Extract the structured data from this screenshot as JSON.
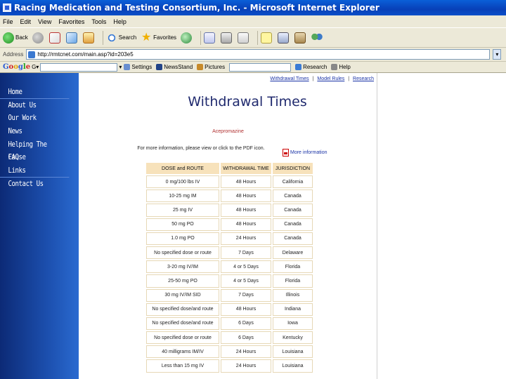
{
  "window": {
    "title": "Racing Medication and Testing Consortium, Inc. - Microsoft Internet Explorer"
  },
  "menubar": {
    "items": [
      "File",
      "Edit",
      "View",
      "Favorites",
      "Tools",
      "Help"
    ]
  },
  "toolbar": {
    "back_label": "Back",
    "search_label": "Search",
    "favorites_label": "Favorites"
  },
  "addressbar": {
    "label": "Address",
    "url": "http://rmtcnet.com/main.asp?id=203e5"
  },
  "googlebar": {
    "logo": "Google",
    "settings_label": "Settings",
    "newsstand_label": "NewsStand",
    "pictures_label": "Pictures",
    "research_label": "Research",
    "help_label": "Help"
  },
  "sidebar": {
    "items": [
      "Home",
      "About Us",
      "Our Work",
      "News",
      "Helping The Cause",
      "FAQ",
      "Links",
      "Contact Us"
    ]
  },
  "page": {
    "toplinks": [
      "Withdrawal Times",
      "Model Rules",
      "Research"
    ],
    "title": "Withdrawal Times",
    "subtitle": "Acepromazine",
    "intro": "For more information, please view or click to the PDF icon.",
    "pdf_link": "More information"
  },
  "table": {
    "headers": [
      "DOSE and ROUTE",
      "WITHDRAWAL TIME",
      "JURISDICTION"
    ],
    "rows": [
      [
        "0 mg/100 lbs IV",
        "48 Hours",
        "California"
      ],
      [
        "10-25 mg IM",
        "48 Hours",
        "Canada"
      ],
      [
        "25 mg IV",
        "48 Hours",
        "Canada"
      ],
      [
        "50 mg PO",
        "48 Hours",
        "Canada"
      ],
      [
        "1.0 mg PO",
        "24 Hours",
        "Canada"
      ],
      [
        "No specified dose or route",
        "7 Days",
        "Delaware"
      ],
      [
        "3-20 mg IV/IM",
        "4 or 5 Days",
        "Florida"
      ],
      [
        "25-50 mg PO",
        "4 or 5 Days",
        "Florida"
      ],
      [
        "30 mg IV/IM SID",
        "7 Days",
        "Illinois"
      ],
      [
        "No specified dose/and route",
        "48 Hours",
        "Indiana"
      ],
      [
        "No specified dose/and route",
        "6 Days",
        "Iowa"
      ],
      [
        "No specified dose or route",
        "6 Days",
        "Kentucky"
      ],
      [
        "40 milligrams IM/IV",
        "24 Hours",
        "Louisiana"
      ],
      [
        "Less than 15 mg IV",
        "24 Hours",
        "Louisiana"
      ]
    ]
  }
}
